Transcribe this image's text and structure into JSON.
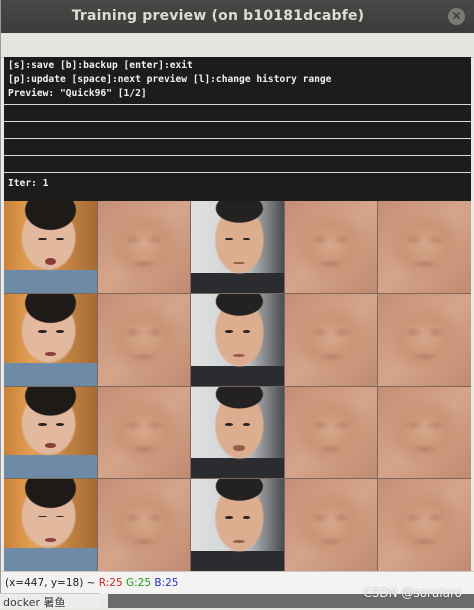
{
  "window": {
    "title": "Training preview (on b10181dcabfe)",
    "close_glyph": "✕"
  },
  "console": {
    "line1": "[s]:save [b]:backup [enter]:exit",
    "line2": "[p]:update [space]:next preview [l]:change history range",
    "line3": "Preview: \"Quick96\" [1/2]",
    "iter": "Iter: 1"
  },
  "preview_grid": {
    "rows": 4,
    "columns": [
      "source-face",
      "source-prediction",
      "destination-face",
      "destination-prediction",
      "swap-prediction"
    ]
  },
  "status": {
    "coords": "(x=447, y=18) ~",
    "r": "R:25",
    "g": "G:25",
    "b": "B:25"
  },
  "watermark": "CSDN @soralaro",
  "background_window": {
    "text": "docker 暑鱼"
  }
}
